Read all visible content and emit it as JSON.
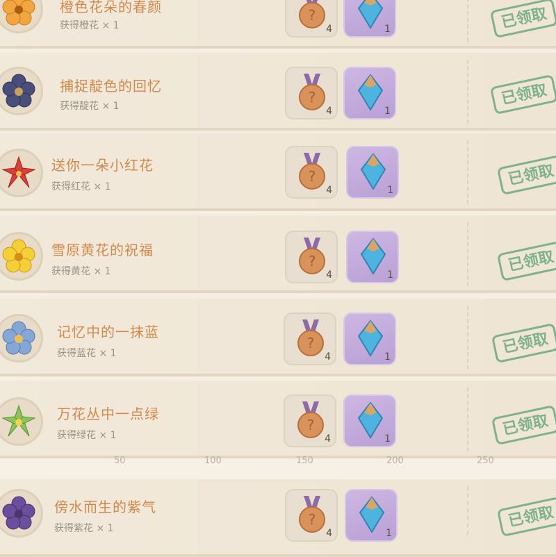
{
  "tasks": [
    {
      "title": "橙色花朵的春颜",
      "reward_text": "获得橙花 × 1",
      "flower_color": "#f2a640",
      "bronze_count": "4",
      "crystal_count": "1",
      "status": "已领取"
    },
    {
      "title": "捕捉靛色的回忆",
      "reward_text": "获得靛花 × 1",
      "flower_color": "#4a4e7a",
      "bronze_count": "4",
      "crystal_count": "1",
      "status": "已领取"
    },
    {
      "title": "送你一朵小红花",
      "reward_text": "获得红花 × 1",
      "flower_color": "#d9403a",
      "bronze_count": "4",
      "crystal_count": "1",
      "status": "已领取"
    },
    {
      "title": "雪原黄花的祝福",
      "reward_text": "获得黄花 × 1",
      "flower_color": "#f4cf3a",
      "bronze_count": "4",
      "crystal_count": "1",
      "status": "已领取"
    },
    {
      "title": "记忆中的一抹蓝",
      "reward_text": "获得蓝花 × 1",
      "flower_color": "#86a6d6",
      "bronze_count": "4",
      "crystal_count": "1",
      "status": "已领取"
    },
    {
      "title": "万花丛中一点绿",
      "reward_text": "获得绿花 × 1",
      "flower_color": "#8cc35a",
      "bronze_count": "4",
      "crystal_count": "1",
      "status": "已领取"
    },
    {
      "title": "傍水而生的紫气",
      "reward_text": "获得紫花 × 1",
      "flower_color": "#6a4f9c",
      "bronze_count": "4",
      "crystal_count": "1",
      "status": "已领取"
    }
  ],
  "axis_ticks": [
    "50",
    "100",
    "150",
    "200",
    "250"
  ],
  "icons": {
    "bronze": "bronze-medal-icon",
    "crystal": "crystal-icon",
    "stamp": "claimed-stamp"
  },
  "colors": {
    "title": "#cf8a4e",
    "stamp": "#7fb28a",
    "crystal_bg": "#c3aadc"
  }
}
